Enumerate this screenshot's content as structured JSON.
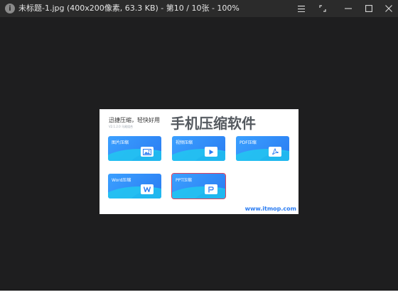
{
  "titlebar": {
    "title": "未标题-1.jpg (400x200像素, 63.3 KB) - 第10 / 10张 - 100%"
  },
  "image": {
    "slogan": "迅捷压缩，轻快好用",
    "version": "V2.1.2.0  马尾组合",
    "headline": "手机压缩软件",
    "url": "www.itmop.com",
    "cards": [
      {
        "label": "图片压缩",
        "icon": "image-icon"
      },
      {
        "label": "视频压缩",
        "icon": "play-icon"
      },
      {
        "label": "PDF压缩",
        "icon": "pdf-icon"
      },
      {
        "label": "Word压缩",
        "icon": "word-icon"
      },
      {
        "label": "PPT压缩",
        "icon": "ppt-icon"
      }
    ]
  },
  "colors": {
    "accent": "#2a7cf2",
    "window_bg": "#1e1e1f",
    "titlebar_bg": "#2b2b2b"
  }
}
